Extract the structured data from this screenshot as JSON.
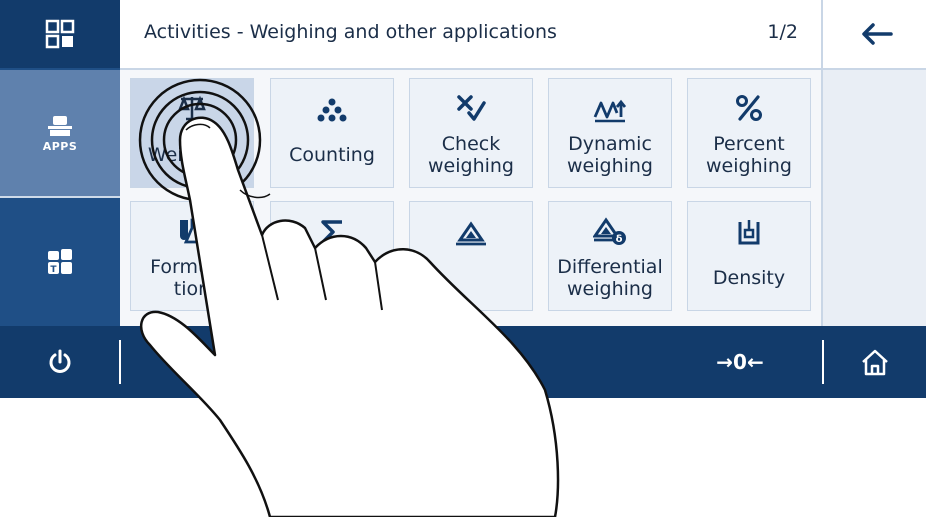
{
  "header": {
    "title": "Activities - Weighing and other applications",
    "page_indicator": "1/2"
  },
  "sidebar": {
    "menu_icon": "grid-menu-icon",
    "apps_label": "APPS",
    "weights_icon": "weights-icon"
  },
  "tiles": [
    {
      "label": "Weighing",
      "icon": "balance-scale-icon",
      "selected": true
    },
    {
      "label": "Counting",
      "icon": "counting-dots-icon"
    },
    {
      "label": "Check\nweighing",
      "icon": "check-weighing-icon"
    },
    {
      "label": "Dynamic\nweighing",
      "icon": "dynamic-weighing-icon"
    },
    {
      "label": "Percent\nweighing",
      "icon": "percent-icon"
    },
    {
      "label": "Formula-\ntion",
      "icon": "formulation-flasks-icon"
    },
    {
      "label": "",
      "icon": "totaling-sigma-icon"
    },
    {
      "label": "",
      "icon": "weighing-pan-icon"
    },
    {
      "label": "Differential\nweighing",
      "icon": "differential-weighing-icon"
    },
    {
      "label": "Density",
      "icon": "density-icon"
    }
  ],
  "footer": {
    "zero_label": "→0←"
  },
  "colors": {
    "primary": "#123b6b",
    "accent": "#5f81ad",
    "tile_bg": "#edf2f8",
    "selected_tile": "#c9d6e8"
  }
}
